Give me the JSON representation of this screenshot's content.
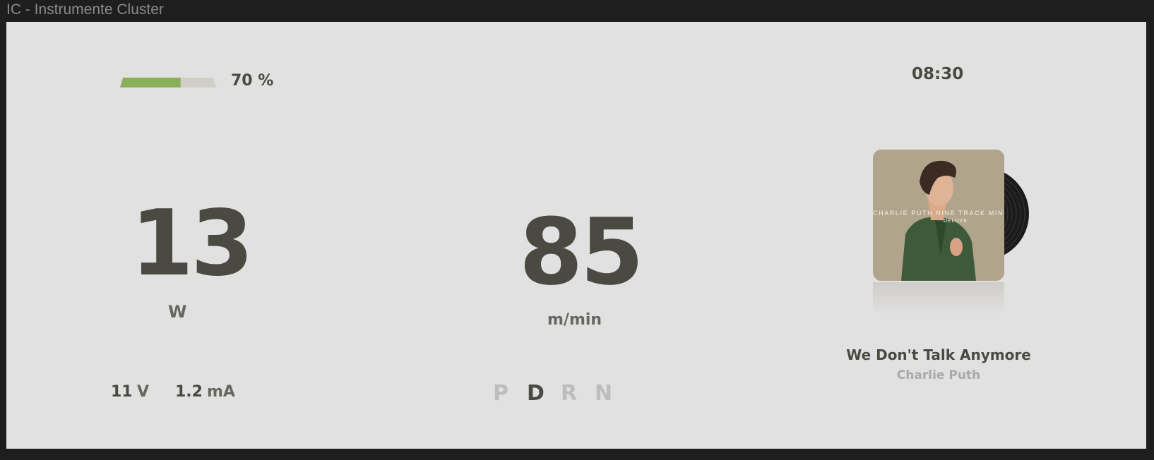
{
  "window": {
    "title": "IC - Instrumente Cluster"
  },
  "battery": {
    "level": 0.7,
    "label": "70 %",
    "fill_color": "#8bb05a",
    "track_color": "#cfcfc8"
  },
  "power": {
    "value": "13",
    "unit": "W"
  },
  "electrics": {
    "voltage": "11",
    "voltage_unit": "V",
    "current": "1.2",
    "current_unit": "mA"
  },
  "speed": {
    "value": "85",
    "unit": "m/min"
  },
  "gears": [
    {
      "label": "P",
      "active": false
    },
    {
      "label": "D",
      "active": true
    },
    {
      "label": "R",
      "active": false
    },
    {
      "label": "N",
      "active": false
    }
  ],
  "clock": {
    "time": "08:30"
  },
  "media": {
    "album_art_text": "CHARLIE PUTH NINE TRACK MIND",
    "album_art_subtext": "DELUXE",
    "track": "We Don't Talk Anymore",
    "artist": "Charlie Puth",
    "icons": [
      "album-cover",
      "vinyl-record-icon"
    ]
  },
  "colors": {
    "text_primary": "#4a4a42",
    "text_muted": "#a9a9a9",
    "panel_bg": "#e1e1e1",
    "window_bg": "#1e1e1e"
  }
}
